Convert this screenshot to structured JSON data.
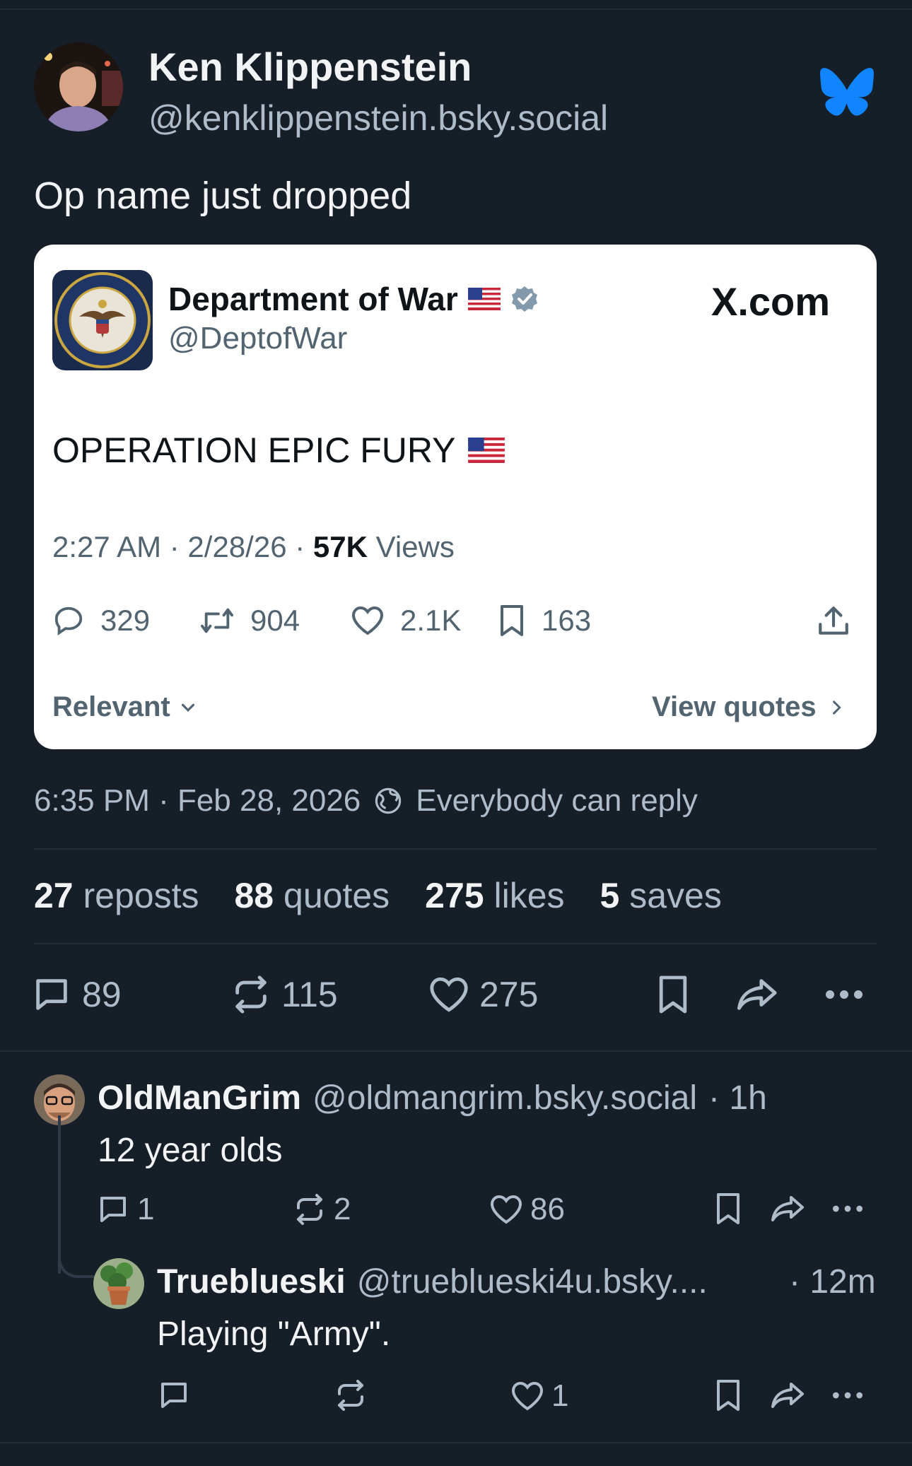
{
  "post": {
    "author_name": "Ken Klippenstein",
    "author_handle": "@kenklippenstein.bsky.social",
    "text": "Op name just dropped",
    "time": "6:35 PM · Feb 28, 2026",
    "reply_setting": "Everybody can reply",
    "counts": [
      {
        "value": "27",
        "label": "reposts"
      },
      {
        "value": "88",
        "label": "quotes"
      },
      {
        "value": "275",
        "label": "likes"
      },
      {
        "value": "5",
        "label": "saves"
      }
    ],
    "actions": {
      "replies": "89",
      "reposts": "115",
      "likes": "275"
    }
  },
  "embed": {
    "name": "Department of War",
    "handle": "@DeptofWar",
    "source": "X.com",
    "text": "OPERATION EPIC FURY",
    "time": "2:27 AM · 2/28/26 · ",
    "views_count": "57K",
    "views_label": " Views",
    "stats": {
      "replies": "329",
      "reposts": "904",
      "likes": "2.1K",
      "bookmarks": "163"
    },
    "relevant_label": "Relevant",
    "view_quotes_label": "View quotes",
    "seal_text": "DEPARTMENT OF WAR · UNITED STATES OF AMERICA"
  },
  "replies": [
    {
      "name": "OldManGrim",
      "handle": "@oldmangrim.bsky.social",
      "age": "· 1h",
      "text": "12 year olds",
      "replies": "1",
      "reposts": "2",
      "likes": "86"
    },
    {
      "name": "Trueblueski",
      "handle": "@trueblueski4u.bsky....",
      "age": "· 12m",
      "text": "Playing \"Army\".",
      "replies": "",
      "reposts": "",
      "likes": "1"
    }
  ],
  "colors": {
    "background": "#161e27",
    "muted": "#aebbc9",
    "bluesky": "#1185fe",
    "card": "#ffffff"
  }
}
